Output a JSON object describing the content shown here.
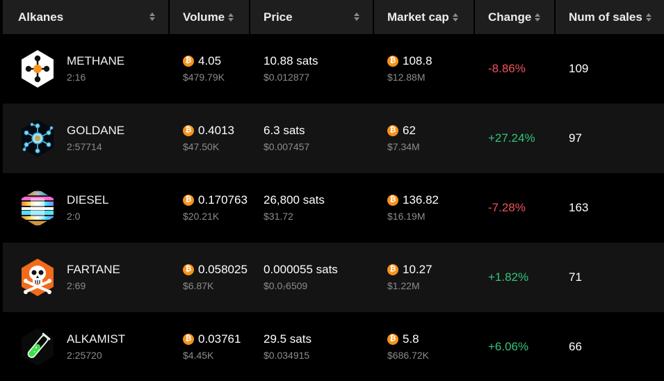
{
  "columns": {
    "alkanes": "Alkanes",
    "volume": "Volume",
    "price": "Price",
    "market_cap": "Market cap",
    "change": "Change",
    "num_sales": "Num of sales"
  },
  "btc_symbol": "₿",
  "colors": {
    "positive": "#35c47a",
    "negative": "#f0525a",
    "btc": "#f7931a"
  },
  "rows": [
    {
      "name": "METHANE",
      "id": "2:16",
      "icon": "methane-molecule-icon",
      "volume": "4.05",
      "volume_usd": "$479.79K",
      "price": "10.88 sats",
      "price_usd": "$0.012877",
      "market_cap": "108.8",
      "market_cap_usd": "$12.88M",
      "change": "-8.86%",
      "sales": "109"
    },
    {
      "name": "GOLDANE",
      "id": "2:57714",
      "icon": "goldane-molecule-icon",
      "volume": "0.4013",
      "volume_usd": "$47.50K",
      "price": "6.3 sats",
      "price_usd": "$0.007457",
      "market_cap": "62",
      "market_cap_usd": "$7.34M",
      "change": "+27.24%",
      "sales": "97"
    },
    {
      "name": "DIESEL",
      "id": "2:0",
      "icon": "diesel-glitch-icon",
      "volume": "0.170763",
      "volume_usd": "$20.21K",
      "price": "26,800 sats",
      "price_usd": "$31.72",
      "market_cap": "136.82",
      "market_cap_usd": "$16.19M",
      "change": "-7.28%",
      "sales": "163"
    },
    {
      "name": "FARTANE",
      "id": "2:69",
      "icon": "skull-crossbones-icon",
      "volume": "0.058025",
      "volume_usd": "$6.87K",
      "price": "0.000055 sats",
      "price_usd": "$0.0₇6509",
      "market_cap": "10.27",
      "market_cap_usd": "$1.22M",
      "change": "+1.82%",
      "sales": "71"
    },
    {
      "name": "ALKAMIST",
      "id": "2:25720",
      "icon": "test-tube-icon",
      "volume": "0.03761",
      "volume_usd": "$4.45K",
      "price": "29.5 sats",
      "price_usd": "$0.034915",
      "market_cap": "5.8",
      "market_cap_usd": "$686.72K",
      "change": "+6.06%",
      "sales": "66"
    }
  ]
}
